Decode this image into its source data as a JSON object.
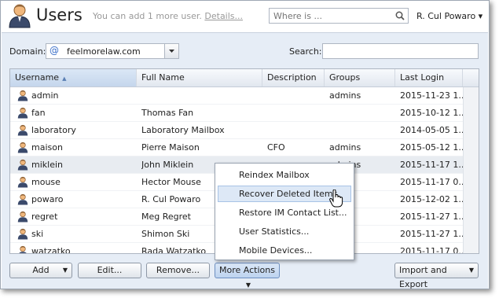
{
  "header": {
    "title": "Users",
    "info_text": "You can add 1 more user.",
    "info_link": "Details...",
    "search_placeholder": "Where is ...",
    "user_menu": "R. Cul Powaro ▾"
  },
  "toolbar": {
    "domain_label": "Domain:",
    "domain_value": "feelmorelaw.com",
    "search_label": "Search:"
  },
  "grid": {
    "columns": [
      "Username",
      "Full Name",
      "Description",
      "Groups",
      "Last Login"
    ],
    "sort_indicator": "▲",
    "rows": [
      {
        "username": "admin",
        "full_name": "",
        "description": "",
        "groups": "admins",
        "last_login": "2015-11-23 1..."
      },
      {
        "username": "fan",
        "full_name": "Thomas Fan",
        "description": "",
        "groups": "",
        "last_login": "2015-10-12 1..."
      },
      {
        "username": "laboratory",
        "full_name": "Laboratory Mailbox",
        "description": "",
        "groups": "",
        "last_login": "2014-05-05 1..."
      },
      {
        "username": "maison",
        "full_name": "Pierre Maison",
        "description": "CFO",
        "groups": "admins",
        "last_login": "2015-05-12 1..."
      },
      {
        "username": "miklein",
        "full_name": "John Miklein",
        "description": "",
        "groups": "admins",
        "last_login": "2015-11-17 1..."
      },
      {
        "username": "mouse",
        "full_name": "Hector Mouse",
        "description": "",
        "groups": "",
        "last_login": "2015-11-17 0..."
      },
      {
        "username": "powaro",
        "full_name": "R. Cul Powaro",
        "description": "",
        "groups": "s",
        "last_login": "2015-12-02 1..."
      },
      {
        "username": "regret",
        "full_name": "Meg Regret",
        "description": "",
        "groups": "s",
        "last_login": "2015-11-27 1..."
      },
      {
        "username": "ski",
        "full_name": "Shimon Ski",
        "description": "",
        "groups": "s",
        "last_login": "2015-11-27 1..."
      },
      {
        "username": "watzatko",
        "full_name": "Rada Watzatko",
        "description": "",
        "groups": "s",
        "last_login": "2015-11-17 0..."
      }
    ]
  },
  "buttons": {
    "add": "Add",
    "edit": "Edit...",
    "remove": "Remove...",
    "more_actions": "More Actions",
    "import_export": "Import and Export"
  },
  "menu": {
    "items": [
      "Reindex Mailbox",
      "Recover Deleted Items",
      "Restore IM Contact List...",
      "User Statistics...",
      "Mobile Devices..."
    ]
  },
  "icons": {
    "app": "users-icon",
    "user": "user-icon",
    "search": "search-icon",
    "domain": "at-sign-icon",
    "cursor": "hand-pointer-icon"
  }
}
